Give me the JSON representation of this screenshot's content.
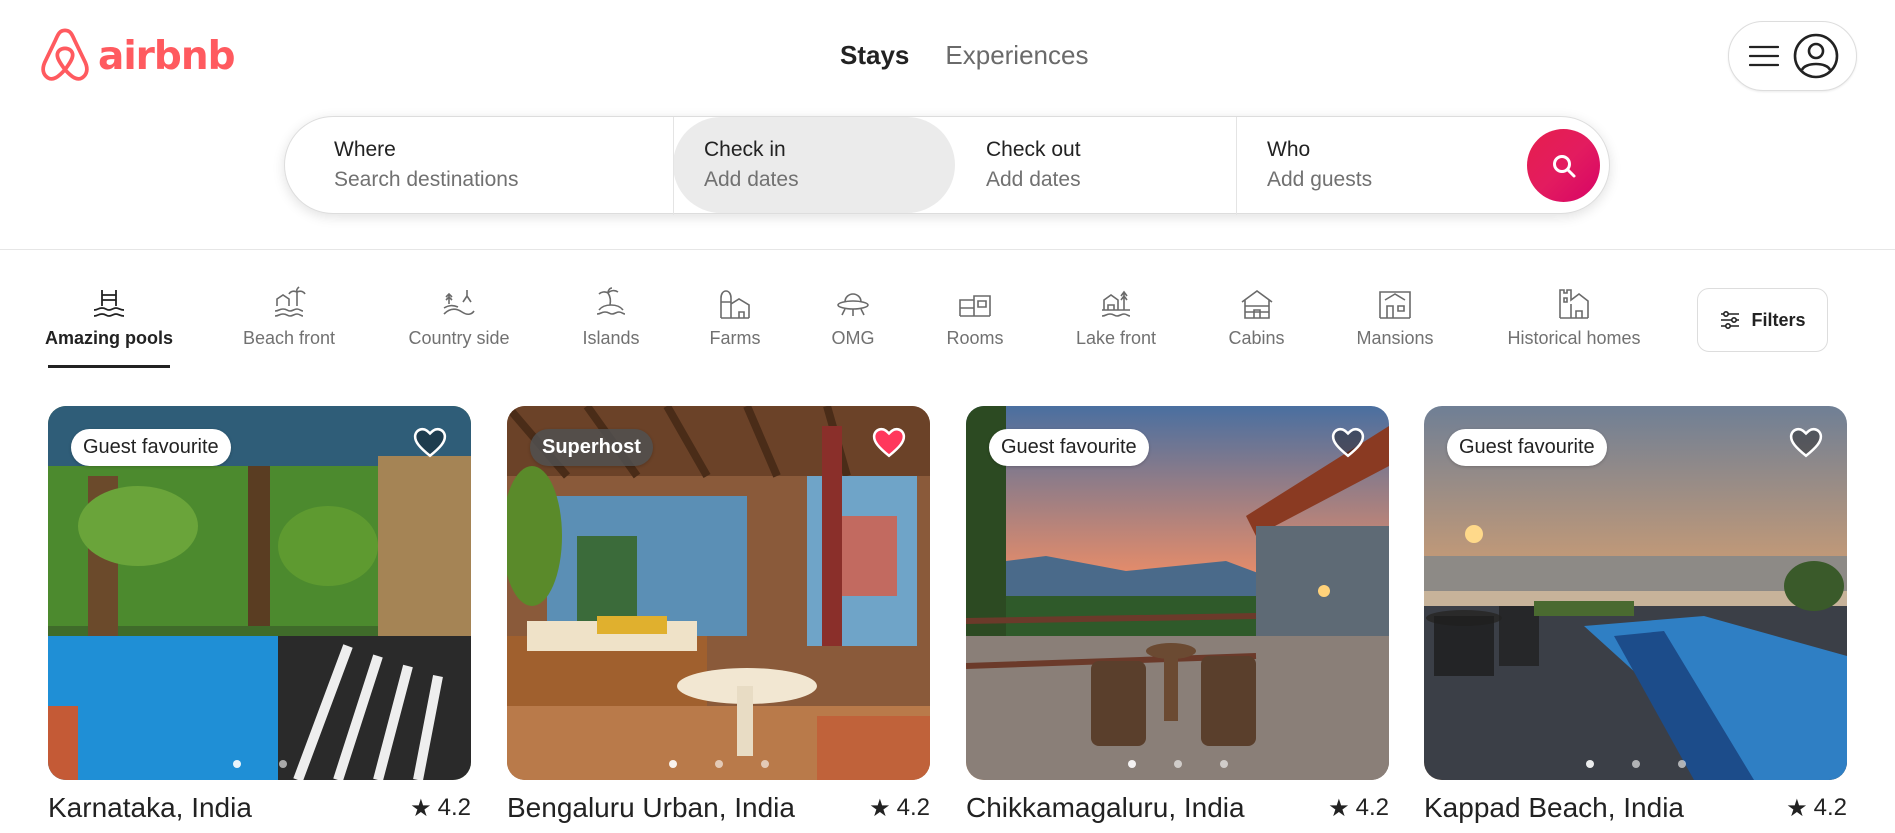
{
  "brand": {
    "name": "airbnb",
    "color": "#ff5a5f"
  },
  "nav": {
    "tabs": [
      {
        "label": "Stays"
      },
      {
        "label": "Experiences"
      }
    ]
  },
  "user_menu": {
    "menu_icon": "hamburger-icon",
    "avatar_icon": "user-circle-icon"
  },
  "search": {
    "where": {
      "label": "Where",
      "placeholder": "Search destinations"
    },
    "checkin": {
      "label": "Check in",
      "placeholder": "Add dates"
    },
    "checkout": {
      "label": "Check out",
      "placeholder": "Add dates"
    },
    "who": {
      "label": "Who",
      "placeholder": "Add guests"
    },
    "button_icon": "search-icon",
    "button_color": "#e31c5f"
  },
  "categories": {
    "items": [
      {
        "label": "Amazing pools",
        "icon": "pool-icon",
        "active": true
      },
      {
        "label": "Beach front",
        "icon": "beach-icon"
      },
      {
        "label": "Country side",
        "icon": "countryside-icon"
      },
      {
        "label": "Islands",
        "icon": "island-icon"
      },
      {
        "label": "Farms",
        "icon": "farm-icon"
      },
      {
        "label": "OMG",
        "icon": "ufo-icon"
      },
      {
        "label": "Rooms",
        "icon": "rooms-icon"
      },
      {
        "label": "Lake front",
        "icon": "lake-icon"
      },
      {
        "label": "Cabins",
        "icon": "cabin-icon"
      },
      {
        "label": "Mansions",
        "icon": "mansion-icon"
      },
      {
        "label": "Historical homes",
        "icon": "castle-icon"
      }
    ],
    "filters_label": "Filters"
  },
  "listings": [
    {
      "title": "Karnataka, India",
      "rating": "4.2",
      "badge": "Guest favourite",
      "favorited": false
    },
    {
      "title": "Bengaluru Urban, India",
      "rating": "4.2",
      "badge": "Superhost",
      "favorited": true
    },
    {
      "title": "Chikkamagaluru, India",
      "rating": "4.2",
      "badge": "Guest favourite",
      "favorited": false
    },
    {
      "title": "Kappad Beach, India",
      "rating": "4.2",
      "badge": "Guest favourite",
      "favorited": false
    }
  ]
}
